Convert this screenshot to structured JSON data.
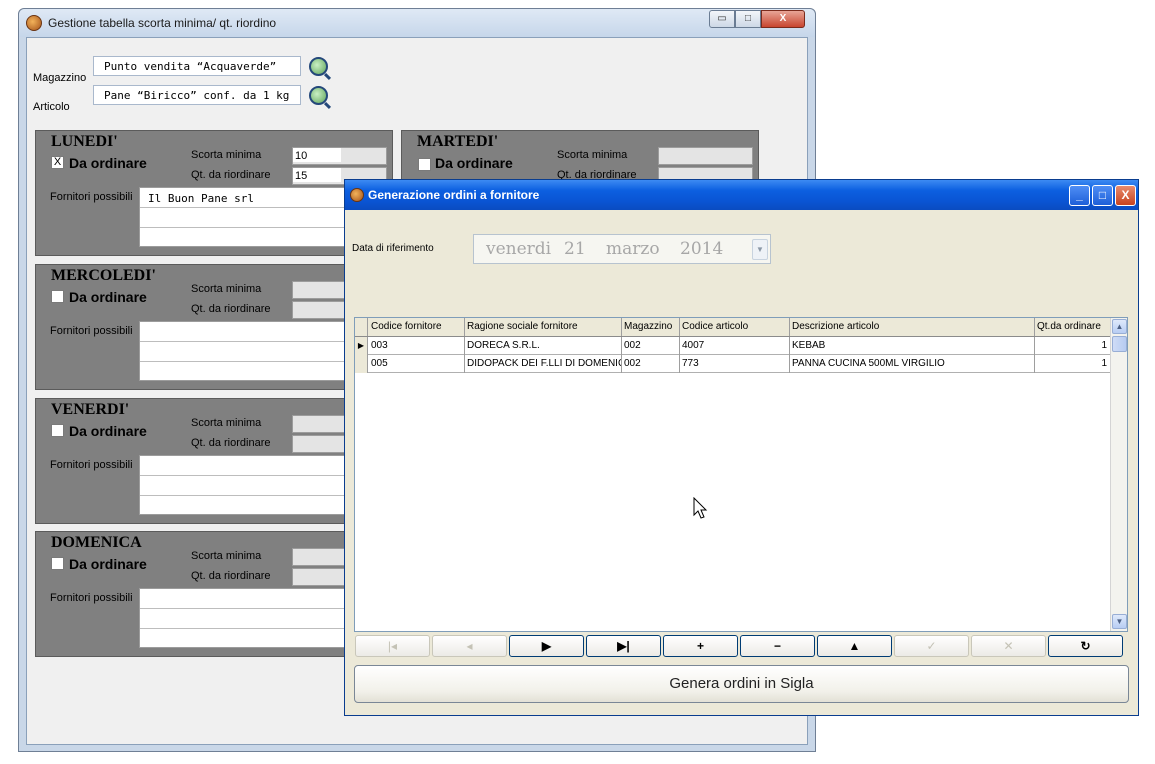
{
  "bg_window": {
    "title": "Gestione tabella scorta minima/ qt. riordino",
    "controls": {
      "minimize": "▭",
      "maximize": "□",
      "close": "X"
    },
    "magazzino_label": "Magazzino",
    "magazzino_value": "Punto vendita “Acquaverde”",
    "articolo_label": "Articolo",
    "articolo_value": "Pane “Biricco” conf. da 1 kg",
    "scorta_label": "Scorta minima",
    "qt_label": "Qt. da riordinare",
    "ord_label": "Da ordinare",
    "fornitori_label": "Fornitori possibili",
    "days": [
      {
        "name": "LUNEDI'",
        "checked": "X",
        "scorta": "10",
        "qt": "15",
        "fornitore": "Il Buon Pane  srl"
      },
      {
        "name": "MARTEDI'",
        "checked": "",
        "scorta": "",
        "qt": "",
        "fornitore": ""
      },
      {
        "name": "MERCOLEDI'",
        "checked": "",
        "scorta": "",
        "qt": "",
        "fornitore": ""
      },
      {
        "name": "VENERDI'",
        "checked": "",
        "scorta": "",
        "qt": "",
        "fornitore": ""
      },
      {
        "name": "DOMENICA",
        "checked": "",
        "scorta": "",
        "qt": "",
        "fornitore": ""
      }
    ]
  },
  "dialog": {
    "title": "Generazione ordini a fornitore",
    "controls": {
      "minimize": "_",
      "maximize": "□",
      "close": "X"
    },
    "date_label": "Data di riferimento",
    "date": {
      "weekday": "venerdi",
      "day": "21",
      "month": "marzo",
      "year": "2014"
    },
    "grid": {
      "headers": [
        "Codice fornitore",
        "Ragione sociale fornitore",
        "Magazzino",
        "Codice articolo",
        "Descrizione articolo",
        "Qt.da ordinare"
      ],
      "rows": [
        [
          "003",
          "DORECA S.R.L.",
          "002",
          "4007",
          "KEBAB",
          "1"
        ],
        [
          "005",
          "DIDOPACK DEI F.LLI DI DOMENICO",
          "002",
          "773",
          "PANNA CUCINA 500ML VIRGILIO",
          "1"
        ]
      ],
      "current_row_marker": "▶"
    },
    "nav_buttons": [
      {
        "name": "first-record-button",
        "symbol": "|◂",
        "enabled": false
      },
      {
        "name": "prior-record-button",
        "symbol": "◂",
        "enabled": false
      },
      {
        "name": "next-record-button",
        "symbol": "▶",
        "enabled": true
      },
      {
        "name": "last-record-button",
        "symbol": "▶|",
        "enabled": true
      },
      {
        "name": "insert-record-button",
        "symbol": "+",
        "enabled": true
      },
      {
        "name": "delete-record-button",
        "symbol": "−",
        "enabled": true
      },
      {
        "name": "edit-record-button",
        "symbol": "▲",
        "enabled": true
      },
      {
        "name": "post-record-button",
        "symbol": "✓",
        "enabled": false
      },
      {
        "name": "cancel-record-button",
        "symbol": "✕",
        "enabled": false
      },
      {
        "name": "refresh-records-button",
        "symbol": "↻",
        "enabled": true
      }
    ],
    "generate_button": "Genera ordini in Sigla"
  }
}
